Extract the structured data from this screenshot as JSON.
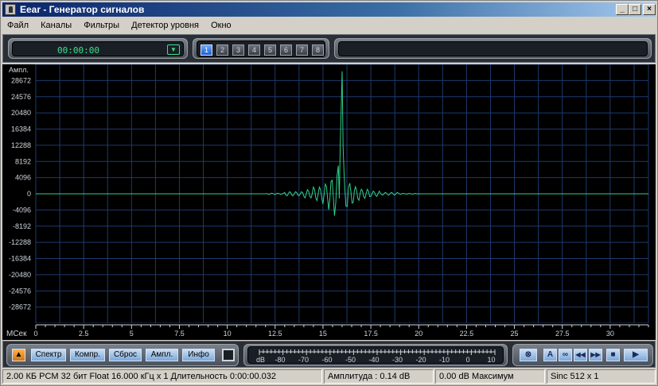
{
  "window": {
    "title": "Eear - Генератор сигналов",
    "min_label": "_",
    "max_label": "□",
    "close_label": "×"
  },
  "menu": [
    "Файл",
    "Каналы",
    "Фильтры",
    "Детектор уровня",
    "Окно"
  ],
  "toolbar": {
    "timecode": "00:00:00",
    "channels": [
      "1",
      "2",
      "3",
      "4",
      "5",
      "6",
      "7",
      "8"
    ],
    "active_channel": "1"
  },
  "plot": {
    "y_axis_title": "Ампл.",
    "x_axis_title": "МСек",
    "y_ticks": [
      "28672",
      "24576",
      "20480",
      "16384",
      "12288",
      "8192",
      "4096",
      "0",
      "-4096",
      "-8192",
      "-12288",
      "-16384",
      "-20480",
      "-24576",
      "-28672"
    ],
    "x_ticks": [
      "0",
      "2.5",
      "5",
      "7.5",
      "10",
      "12.5",
      "15",
      "17.5",
      "20",
      "22.5",
      "25",
      "27.5",
      "30"
    ],
    "grid_color": "#1d3a6e",
    "signal_color": "#2fd08a"
  },
  "chart_data": {
    "type": "line",
    "title": "",
    "xlabel": "МСек",
    "ylabel": "Ампл.",
    "xlim": [
      0,
      32
    ],
    "ylim": [
      -32768,
      32768
    ],
    "grid": true,
    "series": [
      {
        "name": "",
        "x": [
          0,
          4,
          8,
          12,
          13,
          14,
          14.5,
          15,
          15.3,
          15.6,
          15.8,
          15.9,
          16.0,
          16.1,
          16.2,
          16.4,
          16.7,
          17,
          17.5,
          18,
          19,
          20,
          24,
          28,
          32
        ],
        "values": [
          0,
          0,
          0,
          0,
          300,
          800,
          -1400,
          2200,
          -3200,
          4800,
          -6500,
          12000,
          31000,
          -7200,
          4700,
          -3400,
          2100,
          -1500,
          900,
          -500,
          200,
          0,
          0,
          0,
          0
        ]
      }
    ]
  },
  "bottom": {
    "buttons": [
      "Спектр",
      "Компр.",
      "Сброс",
      "Ампл.",
      "Инфо"
    ],
    "meter_unit": "dB",
    "meter_ticks": [
      "-80",
      "-70",
      "-60",
      "-50",
      "-40",
      "-30",
      "-20",
      "-10",
      "0",
      "10"
    ],
    "right_buttons": [
      "⊗",
      "A",
      "∞",
      "◀◀",
      "▶▶",
      "■",
      "▶"
    ]
  },
  "status": {
    "format": "2.00 КБ PCM 32 бит Float 16.000 кГц x 1  Длительность 0:00:00.032",
    "amplitude": "Амплитуда : 0.14 dB",
    "max": "0.00 dB Максимум",
    "filter": "Sinc 512 x 1"
  }
}
